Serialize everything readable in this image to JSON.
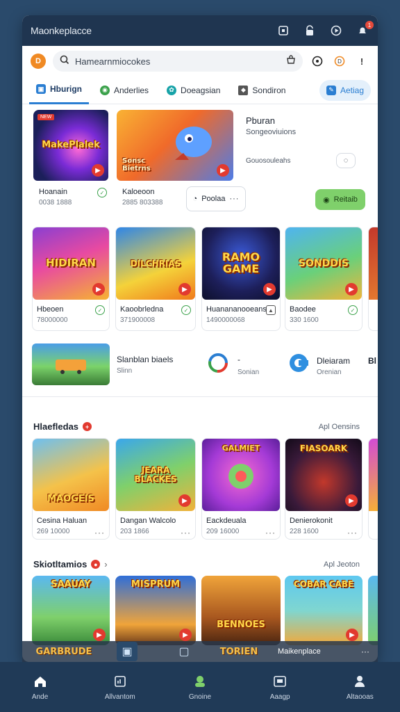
{
  "window": {
    "title": "Maonkeplacce"
  },
  "search": {
    "placeholder": "Hamearnmiocokes",
    "logo_letter": "D"
  },
  "tabs": [
    {
      "label": "Hburign",
      "icon": "storefront-icon",
      "color": "#2a7ed2"
    },
    {
      "label": "Anderlies",
      "icon": "android-icon",
      "color": "#3aa14a"
    },
    {
      "label": "Doeagsian",
      "icon": "design-icon",
      "color": "#18a3a8"
    },
    {
      "label": "Sondiron",
      "icon": "cube-icon",
      "color": "#444444"
    },
    {
      "label": "Aetiag",
      "icon": "tag-icon",
      "color": "#2a7ed2"
    }
  ],
  "featured": {
    "cards": [
      {
        "title": "MakePlalek",
        "name": "Hoanain",
        "sub": "0038 1888",
        "tag": "NEW"
      },
      {
        "title": "Sonsc Bietrns",
        "name": "Kaloeoon",
        "sub": "2885 803388",
        "tag": ""
      }
    ],
    "info": {
      "title": "Pburan",
      "sub": "Songeoviuions",
      "meta": "Gouosouleahs"
    },
    "action_label": "Poolaa",
    "primary_label": "Reitaib"
  },
  "row1": [
    {
      "title": "HIDIRAN",
      "name": "Hbeoen",
      "sub": "78000000"
    },
    {
      "title": "DILCHRIAS",
      "name": "Kaoobrledna",
      "sub": "371900008"
    },
    {
      "title": "RAMO GAME",
      "name": "Huanananooeans",
      "sub": "1490000068"
    },
    {
      "title": "SONDDIS",
      "name": "Baodee",
      "sub": "330 1600"
    }
  ],
  "promo": {
    "title": "Slanblan biaels",
    "sub": "Slinn",
    "brand1_label": "Sonian",
    "brand2_title": "Dleiaram",
    "brand2_sub": "Orenian",
    "edge_label": "Bl"
  },
  "section2": {
    "title": "Hlaefledas",
    "link": "Apl Oensins",
    "cards": [
      {
        "title": "MAOGEIS",
        "name": "Cesina Haluan",
        "sub": "269 10000"
      },
      {
        "title": "JEARA BLACKES",
        "name": "Dangan Walcolo",
        "sub": "203 1866"
      },
      {
        "title": "GALMIET",
        "name": "Eackdeuala",
        "sub": "209 16000"
      },
      {
        "title": "FIASOARK",
        "name": "Denierokonit",
        "sub": "228 1600"
      }
    ]
  },
  "section3": {
    "title": "Skiotltamios",
    "link": "Apl Jeoton",
    "cards": [
      {
        "title": "SAAUAY",
        "bottom": "GARBRUDE"
      },
      {
        "title": "MISPRUM",
        "bottom": ""
      },
      {
        "title": "BENNOES",
        "bottom": "TORIEN"
      },
      {
        "title": "COBAR CABE",
        "bottom": "Maikenplace"
      }
    ]
  },
  "nav": [
    {
      "label": "Ande",
      "icon": "home-icon"
    },
    {
      "label": "Allvantom",
      "icon": "chart-icon"
    },
    {
      "label": "Gnoine",
      "icon": "profile-group-icon"
    },
    {
      "label": "Aaagp",
      "icon": "app-window-icon"
    },
    {
      "label": "Altaooas",
      "icon": "user-icon"
    }
  ]
}
